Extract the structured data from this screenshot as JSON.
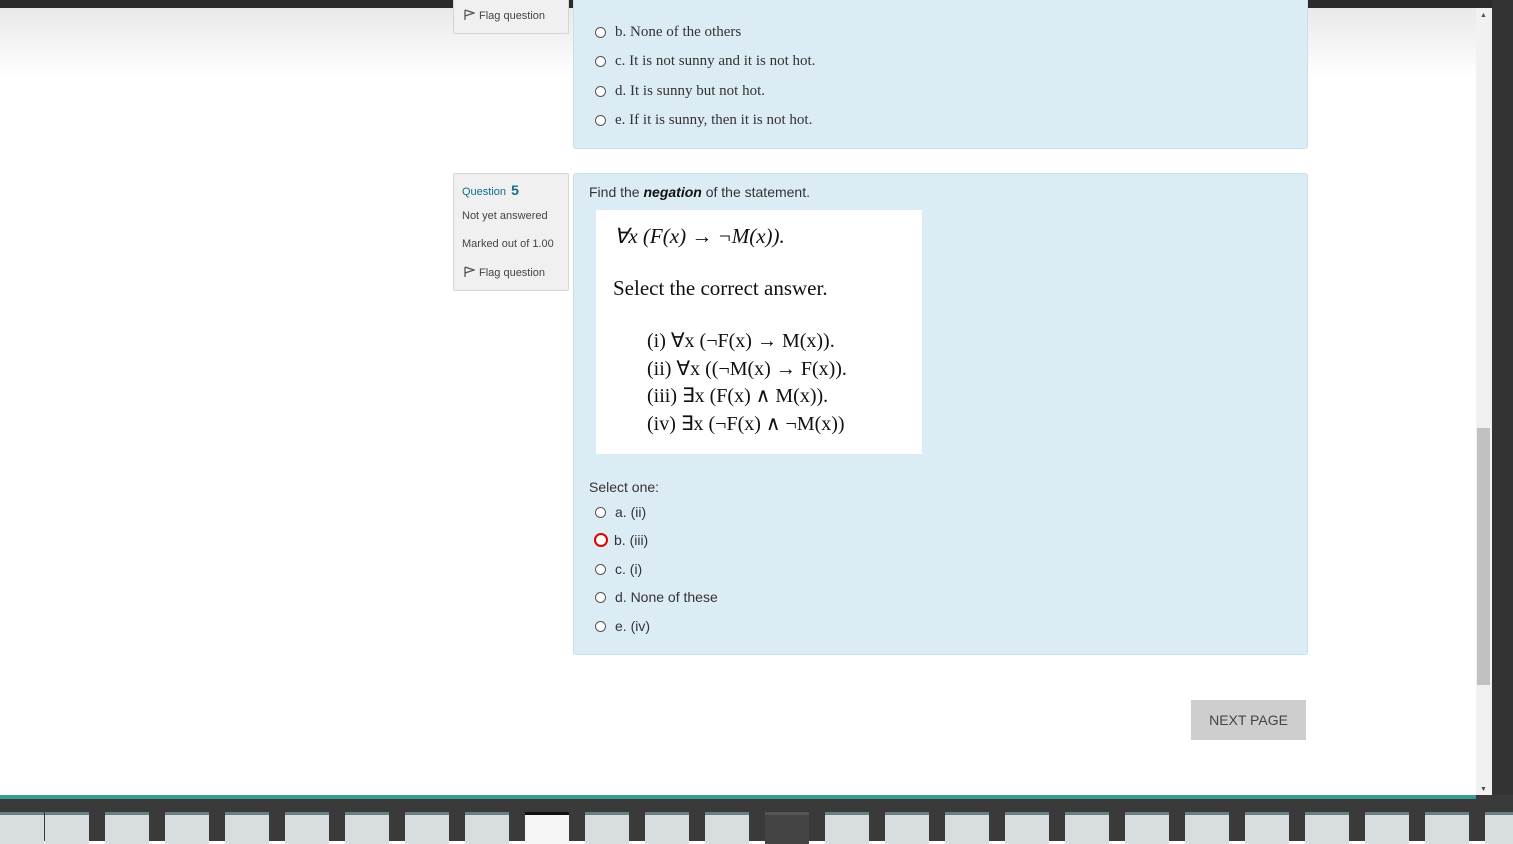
{
  "question4": {
    "flag_label": "Flag question",
    "options": [
      "b. None of the others",
      "c. It is not sunny and it is not hot.",
      "d. It is sunny but not hot.",
      "e. If it is sunny, then it is not hot."
    ]
  },
  "question5": {
    "question_label": "Question",
    "number": "5",
    "state": "Not yet answered",
    "grade": "Marked out of 1.00",
    "flag_label": "Flag question",
    "text_before": "Find the",
    "text_emphasis": "negation",
    "text_after": "of the statement.",
    "image": {
      "formula": "∀x (F(x) → ¬M(x)).",
      "select_prompt": "Select the correct answer.",
      "items": [
        "(i) ∀x (¬F(x) → M(x)).",
        "(ii) ∀x ((¬M(x) → F(x)).",
        "(iii) ∃x (F(x) ∧ M(x)).",
        "(iv) ∃x (¬F(x) ∧ ¬M(x))"
      ]
    },
    "select_one": "Select one:",
    "options": [
      "a. (ii)",
      "b. (iii)",
      "c. (i)",
      "d. None of these",
      "e. (iv)"
    ],
    "marked_option": "b. (iii)"
  },
  "navigation": {
    "next_label": "NEXT PAGE"
  },
  "colors": {
    "content_bg": "#dcecf5",
    "info_bg": "#f0f0f0",
    "accent": "#0f6e8c",
    "mark": "#e00000"
  },
  "icons": [
    "flag-icon",
    "radio-icon",
    "scroll-up-icon",
    "scroll-down-icon"
  ]
}
